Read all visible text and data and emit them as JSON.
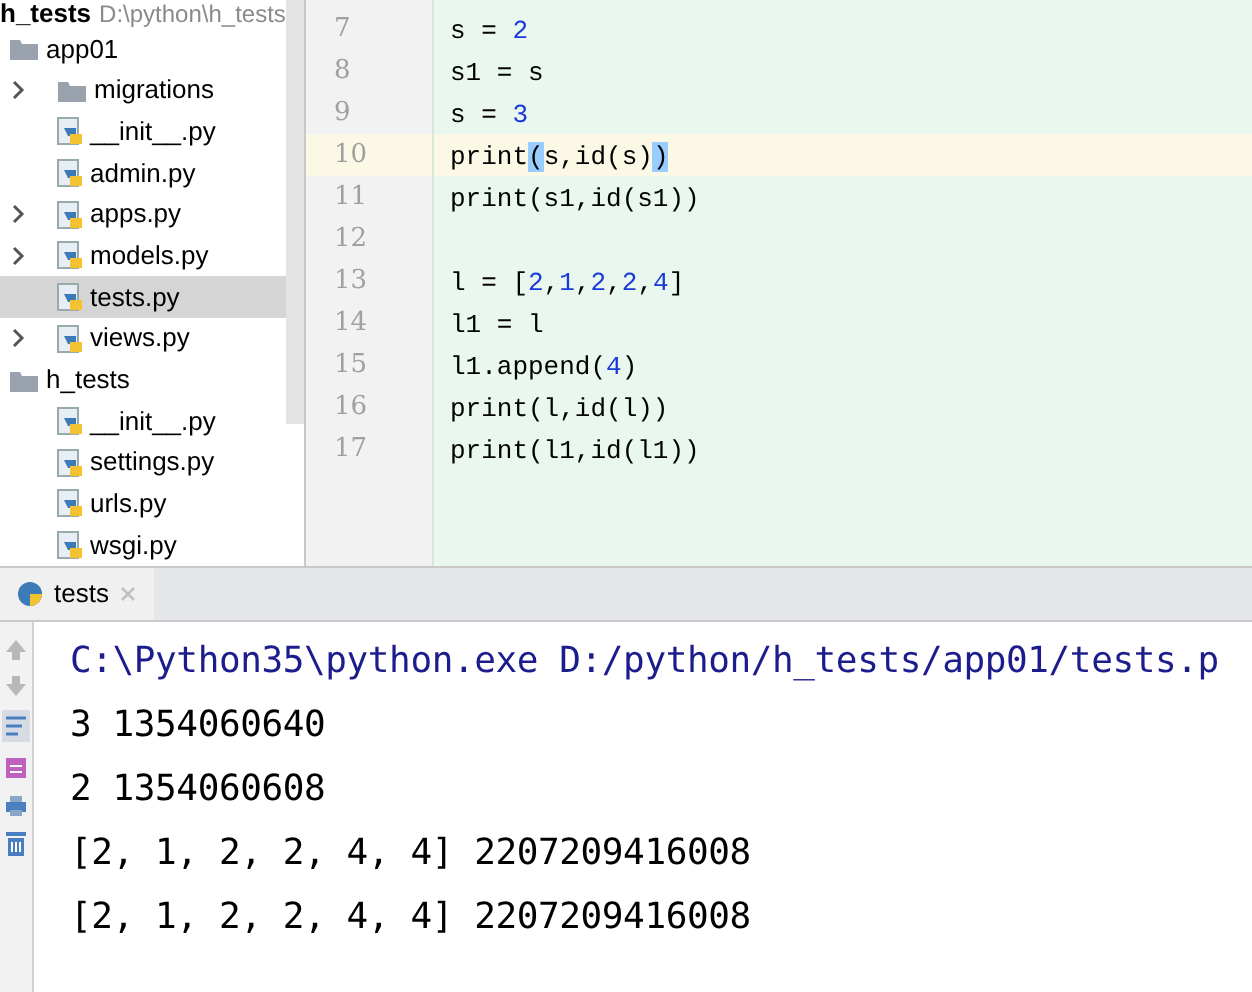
{
  "project_header": {
    "name": "h_tests",
    "path": "D:\\python\\h_tests"
  },
  "tree": [
    {
      "label": "app01",
      "kind": "folder",
      "children": [
        {
          "label": "migrations",
          "kind": "folder",
          "expanded": false,
          "selected": false
        },
        {
          "label": "__init__.py",
          "kind": "python",
          "selected": false
        },
        {
          "label": "admin.py",
          "kind": "python",
          "selected": false
        },
        {
          "label": "apps.py",
          "kind": "python",
          "expanded": false,
          "selected": false
        },
        {
          "label": "models.py",
          "kind": "python",
          "expanded": false,
          "selected": false
        },
        {
          "label": "tests.py",
          "kind": "python",
          "selected": true
        },
        {
          "label": "views.py",
          "kind": "python",
          "expanded": false,
          "selected": false
        }
      ]
    },
    {
      "label": "h_tests",
      "kind": "folder",
      "children": [
        {
          "label": "__init__.py",
          "kind": "python",
          "selected": false
        },
        {
          "label": "settings.py",
          "kind": "python",
          "selected": false
        },
        {
          "label": "urls.py",
          "kind": "python",
          "selected": false
        },
        {
          "label": "wsgi.py",
          "kind": "python",
          "selected": false
        }
      ]
    }
  ],
  "editor": {
    "lines": [
      {
        "number": "7",
        "current": false,
        "tokens": [
          {
            "kind": "text",
            "text": "s = "
          },
          {
            "kind": "number",
            "text": "2"
          }
        ]
      },
      {
        "number": "8",
        "current": false,
        "tokens": [
          {
            "kind": "text",
            "text": "s1 = s"
          }
        ]
      },
      {
        "number": "9",
        "current": false,
        "tokens": [
          {
            "kind": "text",
            "text": "s = "
          },
          {
            "kind": "number",
            "text": "3"
          }
        ]
      },
      {
        "number": "10",
        "current": true,
        "tokens": [
          {
            "kind": "text",
            "text": "print"
          },
          {
            "kind": "match",
            "text": "("
          },
          {
            "kind": "text",
            "text": "s,id(s)"
          },
          {
            "kind": "match",
            "text": ")"
          }
        ]
      },
      {
        "number": "11",
        "current": false,
        "tokens": [
          {
            "kind": "text",
            "text": "print(s1,id(s1))"
          }
        ]
      },
      {
        "number": "12",
        "current": false
      },
      {
        "number": "13",
        "current": false,
        "tokens": [
          {
            "kind": "text",
            "text": "l = ["
          },
          {
            "kind": "number",
            "text": "2"
          },
          {
            "kind": "text",
            "text": ","
          },
          {
            "kind": "number",
            "text": "1"
          },
          {
            "kind": "text",
            "text": ","
          },
          {
            "kind": "number",
            "text": "2"
          },
          {
            "kind": "text",
            "text": ","
          },
          {
            "kind": "number",
            "text": "2"
          },
          {
            "kind": "text",
            "text": ","
          },
          {
            "kind": "number",
            "text": "4"
          },
          {
            "kind": "text",
            "text": "]"
          }
        ]
      },
      {
        "number": "14",
        "current": false,
        "tokens": [
          {
            "kind": "text",
            "text": "l1 = l"
          }
        ]
      },
      {
        "number": "15",
        "current": false,
        "tokens": [
          {
            "kind": "text",
            "text": "l1.append("
          },
          {
            "kind": "number",
            "text": "4"
          },
          {
            "kind": "text",
            "text": ")"
          }
        ]
      },
      {
        "number": "16",
        "current": false,
        "tokens": [
          {
            "kind": "text",
            "text": "print(l,id(l))"
          }
        ]
      },
      {
        "number": "17",
        "current": false,
        "tokens": [
          {
            "kind": "text",
            "text": "print(l1,id(l1))"
          }
        ]
      }
    ]
  },
  "run_tabs": [
    {
      "label": "tests",
      "selected": true
    }
  ],
  "console": [
    {
      "kind": "command",
      "text": "C:\\Python35\\python.exe D:/python/h_tests/app01/tests.p"
    },
    {
      "kind": "output",
      "text": "3 1354060640"
    },
    {
      "kind": "output",
      "text": "2 1354060608"
    },
    {
      "kind": "output",
      "text": "[2, 1, 2, 2, 4, 4] 2207209416008"
    },
    {
      "kind": "output",
      "text": "[2, 1, 2, 2, 4, 4] 2207209416008"
    }
  ]
}
